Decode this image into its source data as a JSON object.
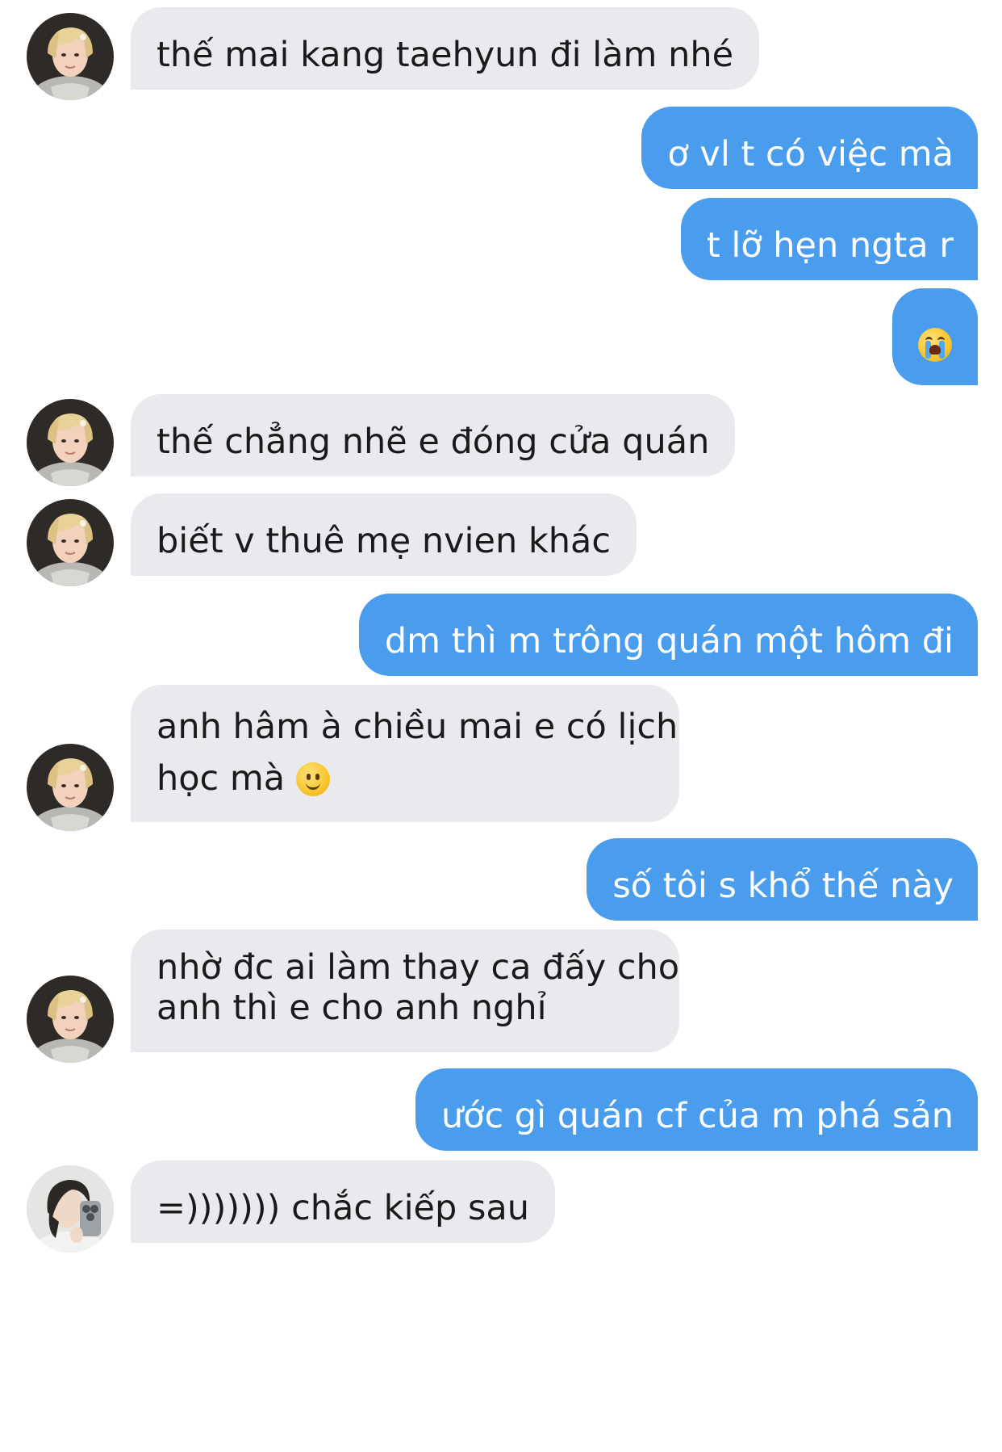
{
  "chat": {
    "messages": [
      {
        "sender": "other",
        "text": "thế mai kang taehyun đi làm nhé"
      },
      {
        "sender": "me",
        "text": "ơ vl t có việc mà"
      },
      {
        "sender": "me",
        "text": "t lỡ hẹn ngta r"
      },
      {
        "sender": "me",
        "emoji": "loudly-crying-face-emoji"
      },
      {
        "sender": "other",
        "text": "thế chẳng nhẽ e đóng cửa quán"
      },
      {
        "sender": "other",
        "text": "biết v thuê mẹ nvien khác"
      },
      {
        "sender": "me",
        "text": "dm thì m trông quán một hôm đi"
      },
      {
        "sender": "other",
        "line1": "anh hâm à chiều mai e có lịch",
        "line2": "học mà",
        "emoji": "slightly-smiling-face-emoji"
      },
      {
        "sender": "me",
        "text": "số tôi s khổ thế này"
      },
      {
        "sender": "other",
        "line1": "nhờ đc ai làm thay ca đấy cho",
        "line2": "anh thì e cho anh nghỉ"
      },
      {
        "sender": "me",
        "text": "ước gì quán cf của m phá sản"
      },
      {
        "sender": "other",
        "text": "=))))))) chắc kiếp sau"
      }
    ]
  },
  "colors": {
    "incoming_bubble": "#e9eaee",
    "outgoing_bubble": "#4a9cec",
    "incoming_text": "#1a1a1a",
    "outgoing_text": "#ffffff"
  }
}
